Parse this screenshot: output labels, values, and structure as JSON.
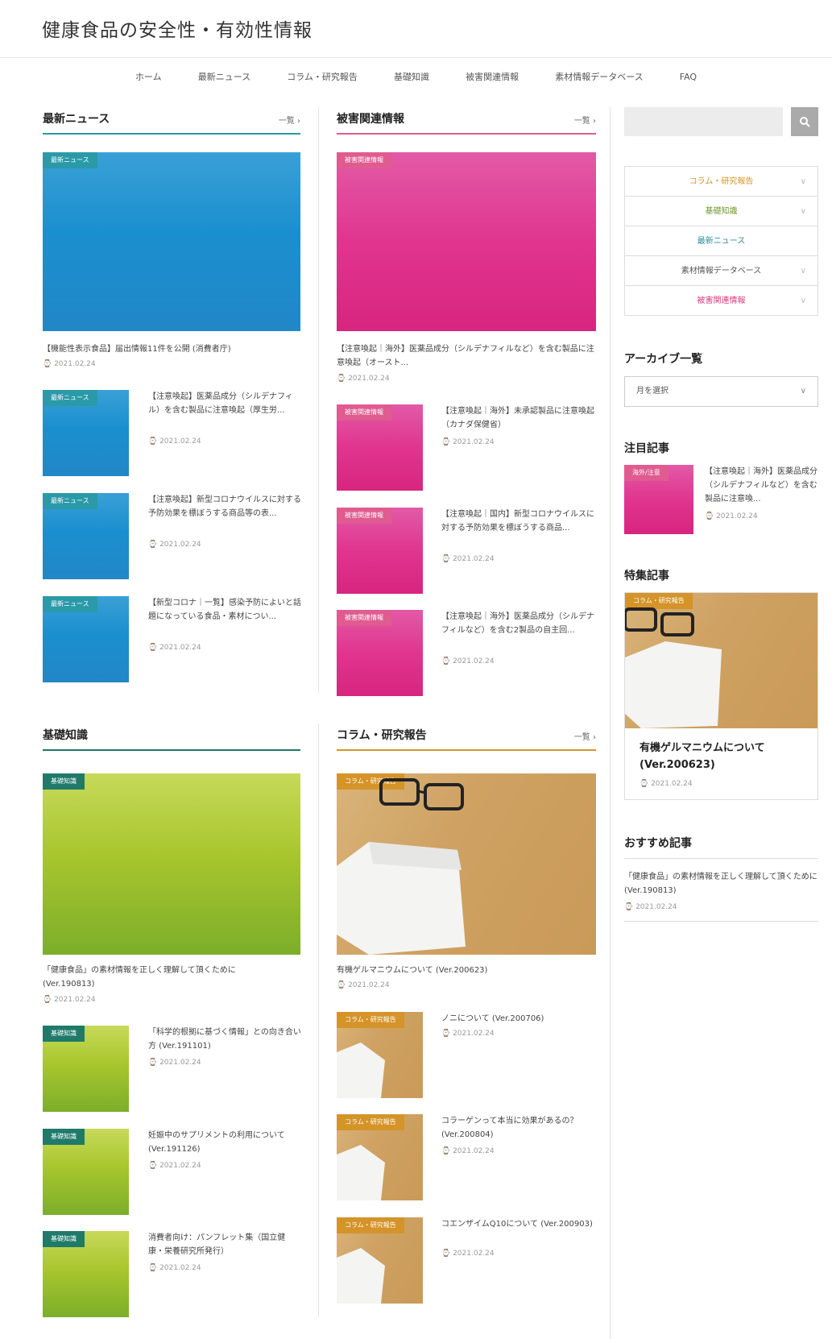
{
  "site": {
    "title": "健康食品の安全性・有効性情報"
  },
  "nav": [
    "ホーム",
    "最新ニュース",
    "コラム・研究報告",
    "基礎知識",
    "被害関連情報",
    "素材情報データベース",
    "FAQ"
  ],
  "common": {
    "more": "一覧 ›"
  },
  "sections": {
    "news": {
      "title": "最新ニュース",
      "category": "最新ニュース",
      "featured": {
        "title": "【機能性表示食品】届出情報11件を公開 (消費者庁)",
        "date": "2021.02.24"
      },
      "items": [
        {
          "title": "【注意喚起】医薬品成分（シルデナフィル）を含む製品に注意喚起（厚生労...",
          "date": "2021.02.24"
        },
        {
          "title": "【注意喚起】新型コロナウイルスに対する予防効果を標ぼうする商品等の表...",
          "date": "2021.02.24"
        },
        {
          "title": "【新型コロナ｜一覧】感染予防によいと話題になっている食品・素材につい...",
          "date": "2021.02.24"
        }
      ]
    },
    "damage": {
      "title": "被害関連情報",
      "category": "被害関連情報",
      "featured": {
        "title": "【注意喚起｜海外】医薬品成分（シルデナフィルなど）を含む製品に注意喚起（オースト...",
        "date": "2021.02.24"
      },
      "items": [
        {
          "title": "【注意喚起｜海外】未承認製品に注意喚起（カナダ保健省）",
          "date": "2021.02.24"
        },
        {
          "title": "【注意喚起｜国内】新型コロナウイルスに対する予防効果を標ぼうする商品...",
          "date": "2021.02.24"
        },
        {
          "title": "【注意喚起｜海外】医薬品成分（シルデナフィルなど）を含む2製品の自主回...",
          "date": "2021.02.24"
        }
      ]
    },
    "basics": {
      "title": "基礎知識",
      "category": "基礎知識",
      "featured": {
        "title": "「健康食品」の素材情報を正しく理解して頂くために (Ver.190813)",
        "date": "2021.02.24"
      },
      "items": [
        {
          "title": "「科学的根拠に基づく情報」との向き合い方 (Ver.191101)",
          "date": "2021.02.24"
        },
        {
          "title": "妊娠中のサプリメントの利用について (Ver.191126)",
          "date": "2021.02.24"
        },
        {
          "title": "消費者向け：パンフレット集（国立健康・栄養研究所発行）",
          "date": "2021.02.24"
        }
      ]
    },
    "column": {
      "title": "コラム・研究報告",
      "category": "コラム・研究報告",
      "featured": {
        "title": "有機ゲルマニウムについて (Ver.200623)",
        "date": "2021.02.24"
      },
      "items": [
        {
          "title": "ノニについて (Ver.200706)",
          "date": "2021.02.24"
        },
        {
          "title": "コラーゲンって本当に効果があるの？ (Ver.200804)",
          "date": "2021.02.24"
        },
        {
          "title": "コエンザイムQ10について (Ver.200903)",
          "date": "2021.02.24"
        }
      ]
    }
  },
  "sidebar": {
    "categories": [
      {
        "label": "コラム・研究報告",
        "color": "#d4942a",
        "arrow": true
      },
      {
        "label": "基礎知識",
        "color": "#6a9a2a",
        "arrow": true
      },
      {
        "label": "最新ニュース",
        "color": "#2a8a9a",
        "arrow": false
      },
      {
        "label": "素材情報データベース",
        "color": "#555555",
        "arrow": true
      },
      {
        "label": "被害関連情報",
        "color": "#d83a80",
        "arrow": true
      }
    ],
    "archive_title": "アーカイブ一覧",
    "archive_select": "月を選択",
    "attention_title": "注目記事",
    "attention": {
      "category": "海外/注意",
      "title": "【注意喚起｜海外】医薬品成分（シルデナフィルなど）を含む製品に注意喚...",
      "date": "2021.02.24"
    },
    "feature_title": "特集記事",
    "feature": {
      "category": "コラム・研究報告",
      "title": "有機ゲルマニウムについて (Ver.200623)",
      "date": "2021.02.24"
    },
    "recommend_title": "おすすめ記事",
    "recommend": {
      "title": "「健康食品」の素材情報を正しく理解して頂くために (Ver.190813)",
      "date": "2021.02.24"
    }
  },
  "colors": {
    "news": "#2a9aa8",
    "damage": "#e05c90",
    "basics": "#1f7a6a",
    "column": "#d4942a"
  }
}
